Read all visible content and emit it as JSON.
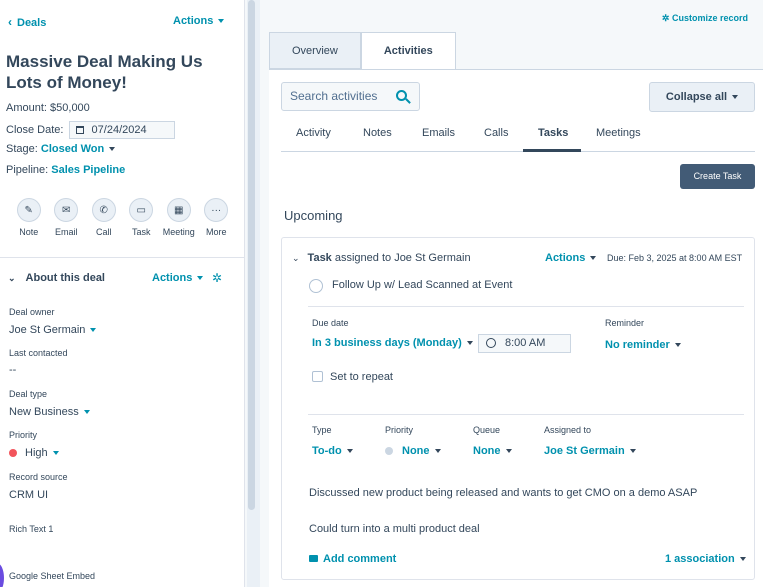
{
  "sidebar": {
    "back_label": "Deals",
    "actions_label": "Actions",
    "deal_title": "Massive Deal Making Us Lots of Money!",
    "amount_label": "Amount:",
    "amount_value": "$50,000",
    "close_date_label": "Close Date:",
    "close_date_value": "07/24/2024",
    "stage_label": "Stage:",
    "stage_value": "Closed Won",
    "pipeline_label": "Pipeline:",
    "pipeline_value": "Sales Pipeline",
    "quick_actions": [
      {
        "label": "Note",
        "icon": "note-icon",
        "glyph": "✎"
      },
      {
        "label": "Email",
        "icon": "email-icon",
        "glyph": "✉"
      },
      {
        "label": "Call",
        "icon": "phone-icon",
        "glyph": "✆"
      },
      {
        "label": "Task",
        "icon": "task-icon",
        "glyph": "▭"
      },
      {
        "label": "Meeting",
        "icon": "calendar-icon",
        "glyph": "▦"
      },
      {
        "label": "More",
        "icon": "more-icon",
        "glyph": "···"
      }
    ],
    "about": {
      "title": "About this deal",
      "actions_label": "Actions",
      "deal_owner_label": "Deal owner",
      "deal_owner_value": "Joe St Germain",
      "last_contacted_label": "Last contacted",
      "last_contacted_value": "--",
      "deal_type_label": "Deal type",
      "deal_type_value": "New Business",
      "priority_label": "Priority",
      "priority_value": "High",
      "record_source_label": "Record source",
      "record_source_value": "CRM UI",
      "rich_text_label": "Rich Text 1",
      "sheet_embed_label": "Google Sheet Embed"
    }
  },
  "main": {
    "customize_label": "Customize record",
    "tabs": [
      {
        "label": "Overview",
        "active": false
      },
      {
        "label": "Activities",
        "active": true
      }
    ],
    "search_placeholder": "Search activities",
    "collapse_label": "Collapse all",
    "sub_tabs": [
      {
        "label": "Activity",
        "active": false
      },
      {
        "label": "Notes",
        "active": false
      },
      {
        "label": "Emails",
        "active": false
      },
      {
        "label": "Calls",
        "active": false
      },
      {
        "label": "Tasks",
        "active": true
      },
      {
        "label": "Meetings",
        "active": false
      }
    ],
    "create_task_label": "Create Task",
    "upcoming_label": "Upcoming",
    "task": {
      "type_word": "Task",
      "assigned_text": "assigned to Joe St Germain",
      "actions_label": "Actions",
      "due_text": "Due: Feb 3, 2025 at 8:00 AM EST",
      "title": "Follow Up w/ Lead Scanned at Event",
      "due_date_label": "Due date",
      "due_date_value": "In 3 business days (Monday)",
      "time_value": "8:00 AM",
      "reminder_label": "Reminder",
      "reminder_value": "No reminder",
      "repeat_label": "Set to repeat",
      "type_label": "Type",
      "type_value": "To-do",
      "priority_label": "Priority",
      "priority_value": "None",
      "queue_label": "Queue",
      "queue_value": "None",
      "assigned_label": "Assigned to",
      "assigned_value": "Joe St Germain",
      "body_line_1": "Discussed new product being released and wants to get CMO on a demo ASAP",
      "body_line_2": "Could turn into a multi product deal",
      "add_comment_label": "Add comment",
      "association_label": "1 association"
    }
  },
  "colors": {
    "accent": "#0091ae",
    "text": "#33475b",
    "button_dark": "#425b76",
    "priority_high": "#f2545b"
  }
}
